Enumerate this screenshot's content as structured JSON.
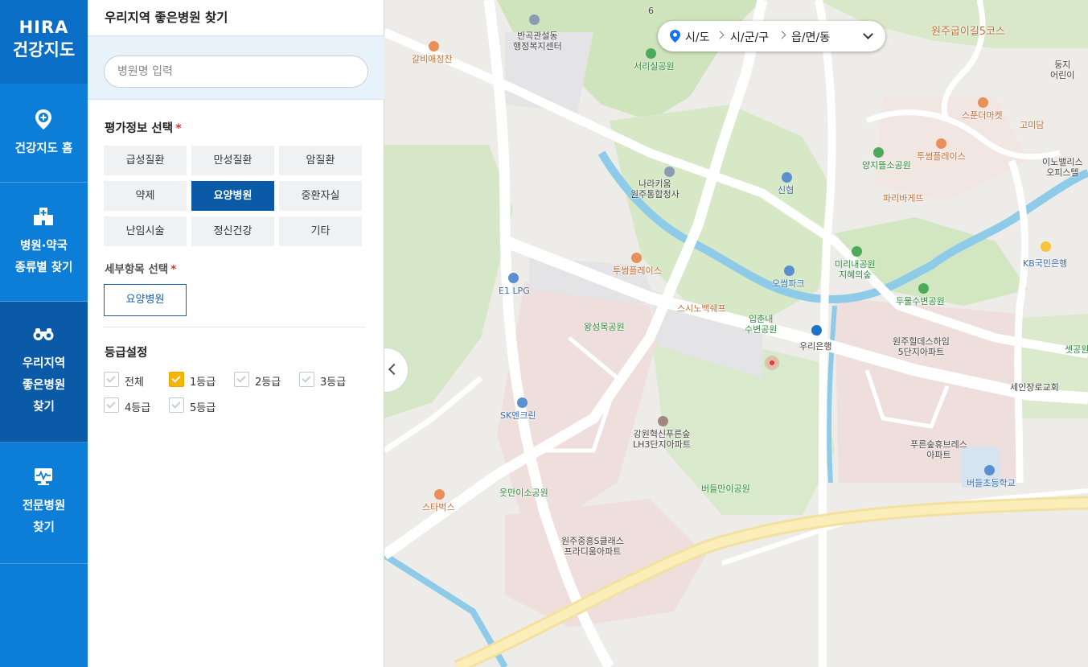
{
  "nav": {
    "logo_line1": "HIRA",
    "logo_line2": "건강지도",
    "items": [
      {
        "label_line1": "건강지도 홈",
        "label_line2": "",
        "icon": "location-plus-icon"
      },
      {
        "label_line1": "병원·약국",
        "label_line2": "종류별 찾기",
        "icon": "hospital-icon"
      },
      {
        "label_line1": "우리지역",
        "label_line2": "좋은병원",
        "label_line3": "찾기",
        "icon": "binoculars-icon"
      },
      {
        "label_line1": "전문병원",
        "label_line2": "찾기",
        "icon": "monitor-pulse-icon"
      }
    ]
  },
  "panel": {
    "title": "우리지역 좋은병원 찾기",
    "search_placeholder": "병원명 입력",
    "eval_title": "평가정보 선택",
    "required_mark": "*",
    "categories": [
      "급성질환",
      "만성질환",
      "암질환",
      "약제",
      "요양병원",
      "중환자실",
      "난임시술",
      "정신건강",
      "기타"
    ],
    "selected_category": "요양병원",
    "detail_title": "세부항목 선택",
    "detail_button": "요양병원",
    "grade_title": "등급설정",
    "grades": [
      {
        "label": "전체",
        "checked": false
      },
      {
        "label": "1등급",
        "checked": true
      },
      {
        "label": "2등급",
        "checked": false
      },
      {
        "label": "3등급",
        "checked": false
      },
      {
        "label": "4등급",
        "checked": false
      },
      {
        "label": "5등급",
        "checked": false
      }
    ]
  },
  "map": {
    "region": {
      "sido": "시/도",
      "sigungu": "시/군/구",
      "dong": "읍/면/동"
    },
    "labels": {
      "l01": "원주굽이길5코스",
      "l02": "반곡관설동",
      "l03": "행정복지센터",
      "l04": "서리실공원",
      "l05": "갈비애정찬",
      "l06": "스푼더마켓",
      "l07": "고미담",
      "l08": "투썸플레이스",
      "l09": "양지뜰소공원",
      "l10": "이노밸리스",
      "l11": "오피스텔",
      "l12": "파리바게뜨",
      "l13": "신협",
      "l14": "나라키움",
      "l15": "원주통합청사",
      "l16": "KB국민은행",
      "l17": "E1 LPG",
      "l18": "투썸플레이스",
      "l19": "미리내공원",
      "l20": "지혜의숲",
      "l21": "오썸파크",
      "l22": "두물수변공원",
      "l23": "스시노백쉐프",
      "l24": "입춘내",
      "l25": "수변공원",
      "l26": "왕성목공원",
      "l27": "우리은행",
      "l28": "원주힐데스하임",
      "l29": "5단지아파트",
      "l30": "셋공원",
      "l31": "세인장로교회",
      "l32": "SK엔크린",
      "l33": "강원혁신푸른숲",
      "l34": "LH3단지아파트",
      "l35": "푸른숲휴브레스",
      "l36": "아파트",
      "l37": "버들초등학교",
      "l38": "웃만이소공원",
      "l39": "버들만이공원",
      "l40": "스타벅스",
      "l41": "원주중흥S클래스",
      "l42": "프라디움아파트",
      "l43": "둥지",
      "l44": "어린이",
      "l45": "6"
    }
  }
}
